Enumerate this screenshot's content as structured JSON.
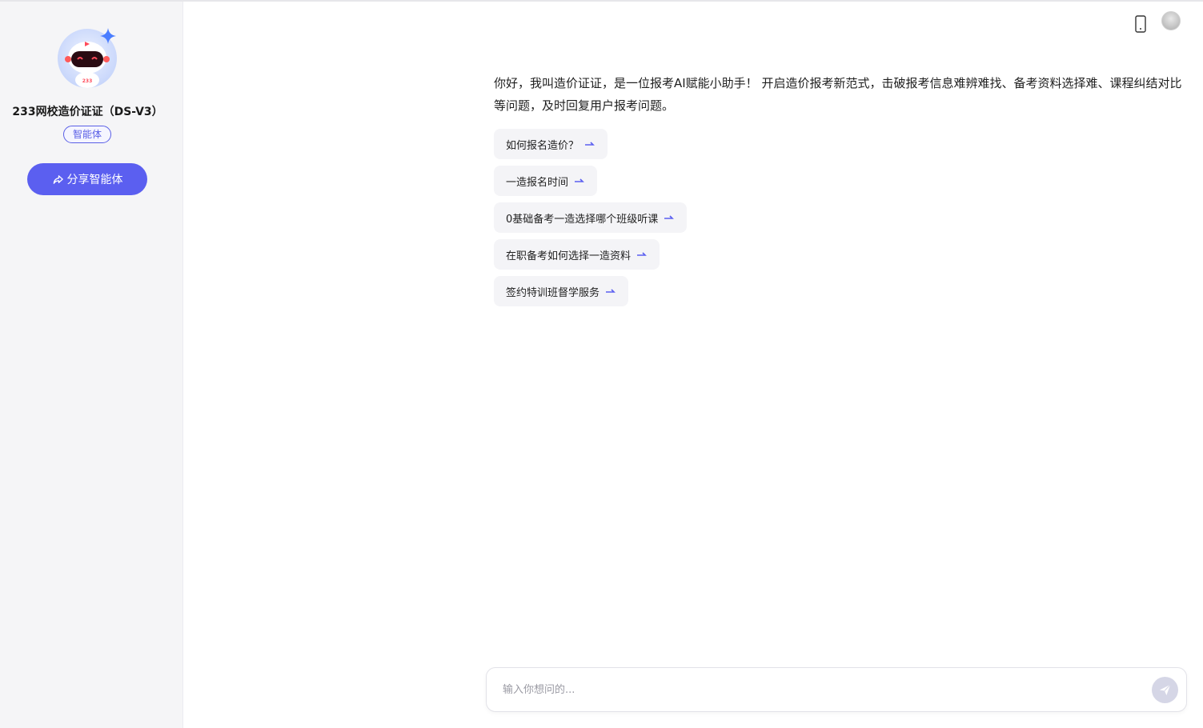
{
  "agent": {
    "name": "233网校造价证证（DS-V3）",
    "badge": "智能体",
    "share_label": "分享智能体",
    "avatar_text": "233"
  },
  "chat": {
    "greeting": "你好，我叫造价证证，是一位报考AI赋能小助手！ 开启造价报考新范式，击破报考信息难辨难找、备考资料选择难、课程纠结对比等问题，及时回复用户报考问题。",
    "suggestions": [
      "如何报名造价？",
      "一造报名时间",
      "0基础备考一造选择哪个班级听课",
      "在职备考如何选择一造资料",
      "签约特训班督学服务"
    ]
  },
  "input": {
    "placeholder": "输入你想问的..."
  },
  "icons": {
    "phone": "phone-icon",
    "user": "user-avatar",
    "share": "share-icon",
    "arrow": "arrow-right-icon",
    "send": "send-icon"
  },
  "colors": {
    "accent": "#5b5ff0",
    "sidebar_bg": "#f5f5f7",
    "chip_bg": "#f4f4f7"
  }
}
